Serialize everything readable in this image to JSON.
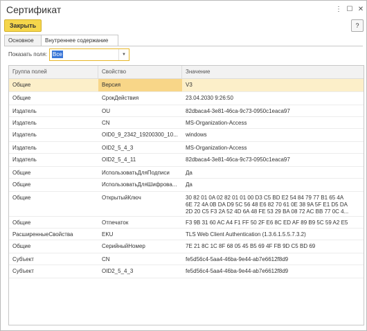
{
  "window": {
    "title": "Сертификат",
    "controls": [
      "⋮",
      "☐",
      "✕"
    ]
  },
  "toolbar": {
    "close_label": "Закрыть",
    "help_label": "?"
  },
  "tabs": [
    {
      "label": "Основное"
    },
    {
      "label": "Внутреннее содержание"
    }
  ],
  "filter": {
    "label": "Показать поля:",
    "value": "Все"
  },
  "table": {
    "columns": [
      "Группа полей",
      "Свойство",
      "Значение"
    ],
    "rows": [
      {
        "group": "Общие",
        "property": "Версия",
        "value": "V3"
      },
      {
        "group": "Общие",
        "property": "СрокДействия",
        "value": "23.04.2030 9:26:50"
      },
      {
        "group": "Издатель",
        "property": "OU",
        "value": "82dbaca4-3e81-46ca-9c73-0950c1eaca97"
      },
      {
        "group": "Издатель",
        "property": "CN",
        "value": "MS-Organization-Access"
      },
      {
        "group": "Издатель",
        "property": "OID0_9_2342_19200300_10...",
        "value": "windows"
      },
      {
        "group": "Издатель",
        "property": "OID2_5_4_3",
        "value": "MS-Organization-Access"
      },
      {
        "group": "Издатель",
        "property": "OID2_5_4_11",
        "value": "82dbaca4-3e81-46ca-9c73-0950c1eaca97"
      },
      {
        "group": "Общие",
        "property": "ИспользоватьДляПодписи",
        "value": "Да"
      },
      {
        "group": "Общие",
        "property": "ИспользоватьДляШифрова...",
        "value": "Да"
      },
      {
        "group": "Общие",
        "property": "ОткрытыйКлюч",
        "value": "30 82 01 0A 02 82 01 01 00 D3 C5 BD E2 54 84 79 77 B1 65 4A\n6E 72 4A 0B DA D9 5C 56 48 E6 82 70 61 0E 38 9A 5F E1 D5 DA\n2D 20 C5 F3 2A 52 4D 6A 48 FE 53 29 BA 08 72 AC BB 77 0C 4..."
      },
      {
        "group": "Общие",
        "property": "Отпечаток",
        "value": "F3 9B 31 60 AC A4 F1 FF 50 2F E6 8C ED AF 89 B9 5C 59 A2 E5"
      },
      {
        "group": "РасширенныеСвойства",
        "property": "EKU",
        "value": "TLS Web Client Authentication (1.3.6.1.5.5.7.3.2)"
      },
      {
        "group": "Общие",
        "property": "СерийныйНомер",
        "value": "7E 21 8C 1C 8F 68 05 45 B5 69 4F FB 9D C5 BD 69"
      },
      {
        "group": "Субъект",
        "property": "CN",
        "value": "fe5d56c4-5aa4-46ba-9e44-ab7e6612f8d9"
      },
      {
        "group": "Субъект",
        "property": "OID2_5_4_3",
        "value": "fe5d56c4-5aa4-46ba-9e44-ab7e6612f8d9"
      }
    ]
  }
}
